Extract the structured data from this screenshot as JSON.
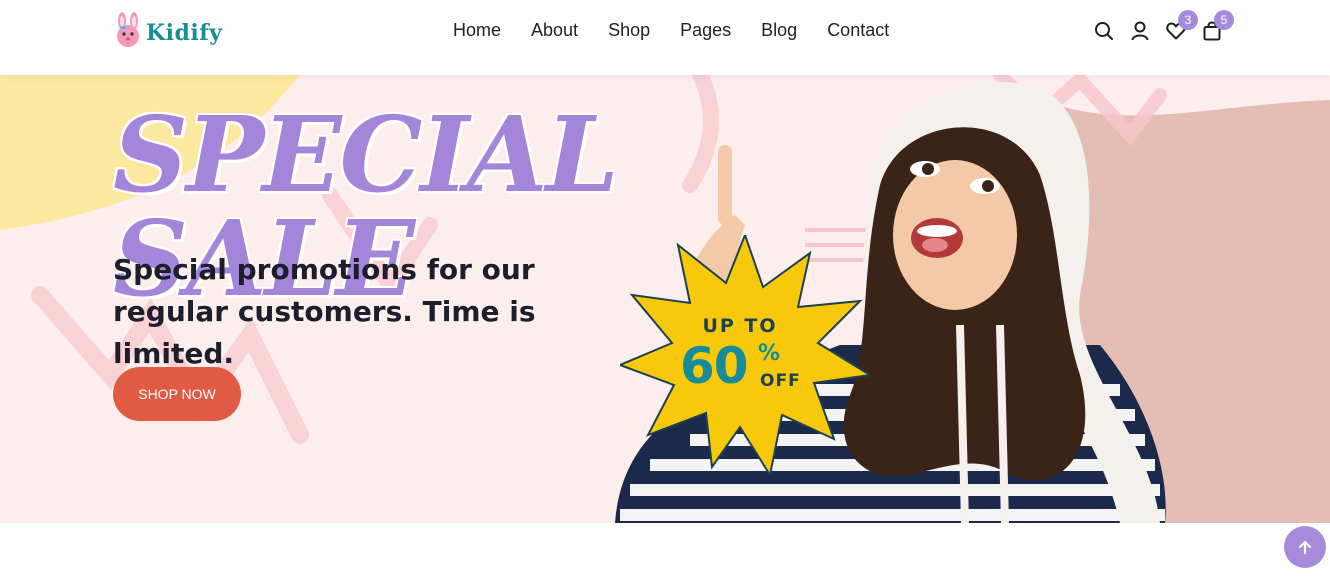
{
  "brand": {
    "name": "Kidify",
    "color": "#178f94",
    "logo_icon": "bunny-logo-icon"
  },
  "nav": {
    "items": [
      {
        "label": "Home"
      },
      {
        "label": "About"
      },
      {
        "label": "Shop"
      },
      {
        "label": "Pages"
      },
      {
        "label": "Blog"
      },
      {
        "label": "Contact"
      }
    ]
  },
  "header_icons": {
    "search": "search-icon",
    "account": "user-icon",
    "wishlist": {
      "icon": "heart-icon",
      "count": "3"
    },
    "cart": {
      "icon": "shopping-bag-icon",
      "count": "5"
    }
  },
  "hero": {
    "title": "SPECIAL SALE",
    "subtitle": "Special promotions for our regular customers. Time is limited.",
    "cta_label": "SHOP NOW",
    "badge": {
      "top": "UP TO",
      "number": "60",
      "percent": "%",
      "bottom": "OFF"
    },
    "image": "girl-in-white-hoodie-pointing-up"
  },
  "colors": {
    "accent_purple": "#a78bdb",
    "cta_red": "#e05a44",
    "badge_yellow": "#f7c90a",
    "teal": "#168b9a",
    "hero_bg": "#fdeeee"
  },
  "scroll_top": {
    "icon": "arrow-up-icon"
  }
}
